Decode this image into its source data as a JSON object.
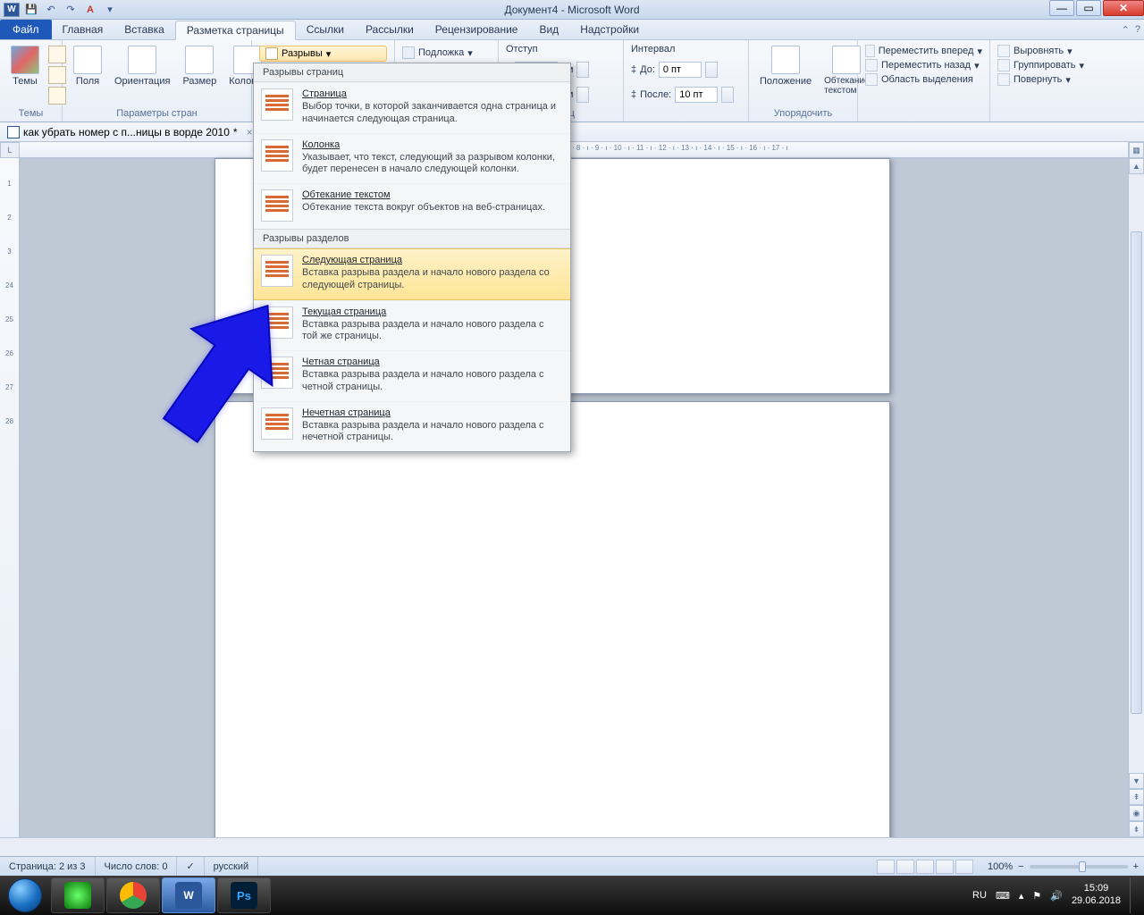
{
  "title": "Документ4 - Microsoft Word",
  "tabs": {
    "file": "Файл",
    "items": [
      "Главная",
      "Вставка",
      "Разметка страницы",
      "Ссылки",
      "Рассылки",
      "Рецензирование",
      "Вид",
      "Надстройки"
    ],
    "active_index": 2
  },
  "ribbon": {
    "themes": {
      "btn": "Темы",
      "group": "Темы"
    },
    "page_setup": {
      "margins": "Поля",
      "orientation": "Ориентация",
      "size": "Размер",
      "columns": "Колонки",
      "breaks": "Разрывы",
      "watermark": "Подложка",
      "group": "Параметры стран"
    },
    "indent_hdr": "Отступ",
    "spacing_hdr": "Интервал",
    "spacing": {
      "before_lbl": "До:",
      "before_val": "0 пт",
      "after_lbl": "После:",
      "after_val": "10 пт",
      "unit": "см"
    },
    "para_group": "Абзац",
    "arrange": {
      "position": "Положение",
      "wrap": "Обтекание текстом",
      "fwd": "Переместить вперед",
      "back": "Переместить назад",
      "sel": "Область выделения",
      "align": "Выровнять",
      "group_cmd": "Группировать",
      "rotate": "Повернуть",
      "group": "Упорядочить"
    }
  },
  "doctab": {
    "name": "как убрать номер с п...ницы в ворде 2010",
    "dirty": "*",
    "close": "×"
  },
  "dropdown": {
    "sec1": "Разрывы страниц",
    "items1": [
      {
        "t": "Страница",
        "d": "Выбор точки, в которой заканчивается одна страница и начинается следующая страница."
      },
      {
        "t": "Колонка",
        "d": "Указывает, что текст, следующий за разрывом колонки, будет перенесен в начало следующей колонки."
      },
      {
        "t": "Обтекание текстом",
        "d": "Обтекание текста вокруг объектов на веб-страницах."
      }
    ],
    "sec2": "Разрывы разделов",
    "items2": [
      {
        "t": "Следующая страница",
        "d": "Вставка разрыва раздела и начало нового раздела со следующей страницы."
      },
      {
        "t": "Текущая страница",
        "d": "Вставка разрыва раздела и начало нового раздела с той же страницы."
      },
      {
        "t": "Четная страница",
        "d": "Вставка разрыва раздела и начало нового раздела с четной страницы."
      },
      {
        "t": "Нечетная страница",
        "d": "Вставка разрыва раздела и начало нового раздела с нечетной страницы."
      }
    ]
  },
  "hruler_text": "· 8 · ı · 9 · ı · 10 · ı · 11 · ı · 12 · ı · 13 · ı · 14 · ı · 15 · ı · 16 · ı · 17 · ı",
  "vruler_ticks": [
    "",
    "1",
    "",
    "2",
    "",
    "3",
    "",
    "24",
    "",
    "25",
    "",
    "26",
    "",
    "27",
    "",
    "28"
  ],
  "status": {
    "page": "Страница: 2 из 3",
    "words": "Число слов: 0",
    "lang": "русский",
    "zoom": "100%"
  },
  "tray": {
    "lang": "RU",
    "time": "15:09",
    "date": "29.06.2018"
  }
}
